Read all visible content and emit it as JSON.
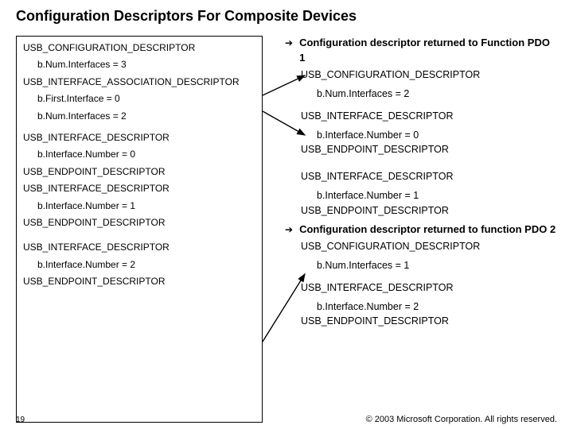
{
  "title": "Configuration Descriptors For Composite Devices",
  "left": {
    "l1": "USB_CONFIGURATION_DESCRIPTOR",
    "l2": "b.Num.Interfaces = 3",
    "l3": "USB_INTERFACE_ASSOCIATION_DESCRIPTOR",
    "l4": "b.First.Interface = 0",
    "l5": "b.Num.Interfaces = 2",
    "l6": "USB_INTERFACE_DESCRIPTOR",
    "l7": "b.Interface.Number = 0",
    "l8": "USB_ENDPOINT_DESCRIPTOR",
    "l9": "USB_INTERFACE_DESCRIPTOR",
    "l10": "b.Interface.Number = 1",
    "l11": "USB_ENDPOINT_DESCRIPTOR",
    "l12": "USB_INTERFACE_DESCRIPTOR",
    "l13": "b.Interface.Number = 2",
    "l14": "USB_ENDPOINT_DESCRIPTOR"
  },
  "right": {
    "h1": "Configuration descriptor returned to Function PDO 1",
    "r1a": "USB_CONFIGURATION_DESCRIPTOR",
    "r1b": "b.Num.Interfaces = 2",
    "r2a": "USB_INTERFACE_DESCRIPTOR",
    "r2b": "b.Interface.Number = 0",
    "r2c": "USB_ENDPOINT_DESCRIPTOR",
    "r3a": "USB_INTERFACE_DESCRIPTOR",
    "r3b": "b.Interface.Number = 1",
    "r3c": "USB_ENDPOINT_DESCRIPTOR",
    "h2": "Configuration descriptor returned to function PDO 2",
    "r4a": "USB_CONFIGURATION_DESCRIPTOR",
    "r4b": "b.Num.Interfaces = 1",
    "r5a": "USB_INTERFACE_DESCRIPTOR",
    "r5b": "b.Interface.Number = 2",
    "r5c": "USB_ENDPOINT_DESCRIPTOR"
  },
  "footer": "© 2003 Microsoft Corporation. All rights reserved.",
  "page": "19",
  "arrow": "➔"
}
